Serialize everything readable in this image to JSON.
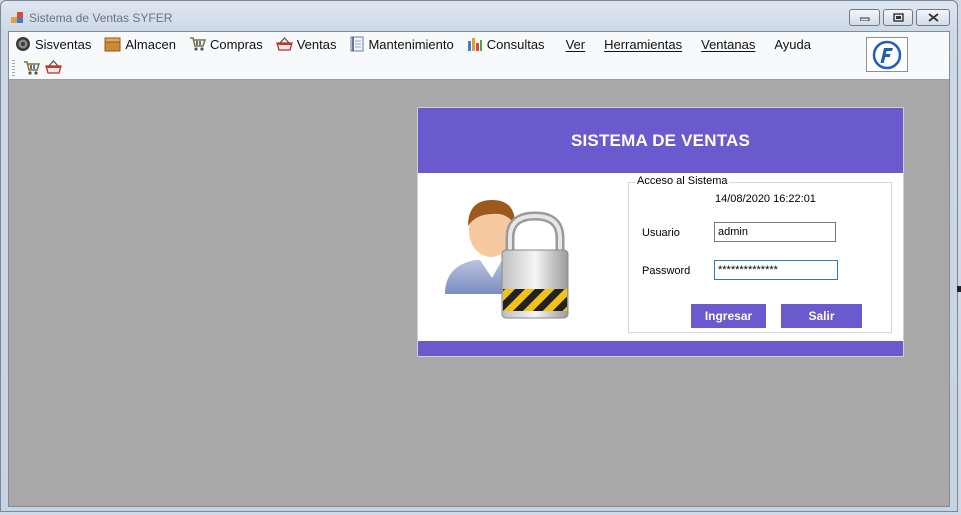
{
  "window": {
    "title": "Sistema de Ventas SYFER",
    "controls": [
      "minimize",
      "maximize",
      "close"
    ]
  },
  "menu": {
    "items": [
      {
        "label": "Sisventas",
        "icon": "gear-icon"
      },
      {
        "label": "Almacen",
        "icon": "box-icon"
      },
      {
        "label": "Compras",
        "icon": "cart-icon"
      },
      {
        "label": "Ventas",
        "icon": "basket-icon"
      },
      {
        "label": "Mantenimiento",
        "icon": "notebook-icon"
      },
      {
        "label": "Consultas",
        "icon": "bar-chart-icon"
      },
      {
        "label": "Ver"
      },
      {
        "label": "Herramientas"
      },
      {
        "label": "Ventanas"
      },
      {
        "label": "Ayuda"
      }
    ]
  },
  "toolbar": {
    "buttons": [
      {
        "icon": "cart-icon"
      },
      {
        "icon": "basket-icon"
      }
    ]
  },
  "logo": {
    "letter": "F",
    "color": "#1f5fb8"
  },
  "login": {
    "header_title": "SISTEMA DE VENTAS",
    "group_title": "Acceso al Sistema",
    "datetime": "14/08/2020 16:22:01",
    "usuario_label": "Usuario",
    "usuario_value": "admin",
    "password_label": "Password",
    "password_value": "**************",
    "ingresar_label": "Ingresar",
    "salir_label": "Salir"
  },
  "colors": {
    "accent": "#6a5acd",
    "workspace": "#a8a8a8"
  }
}
